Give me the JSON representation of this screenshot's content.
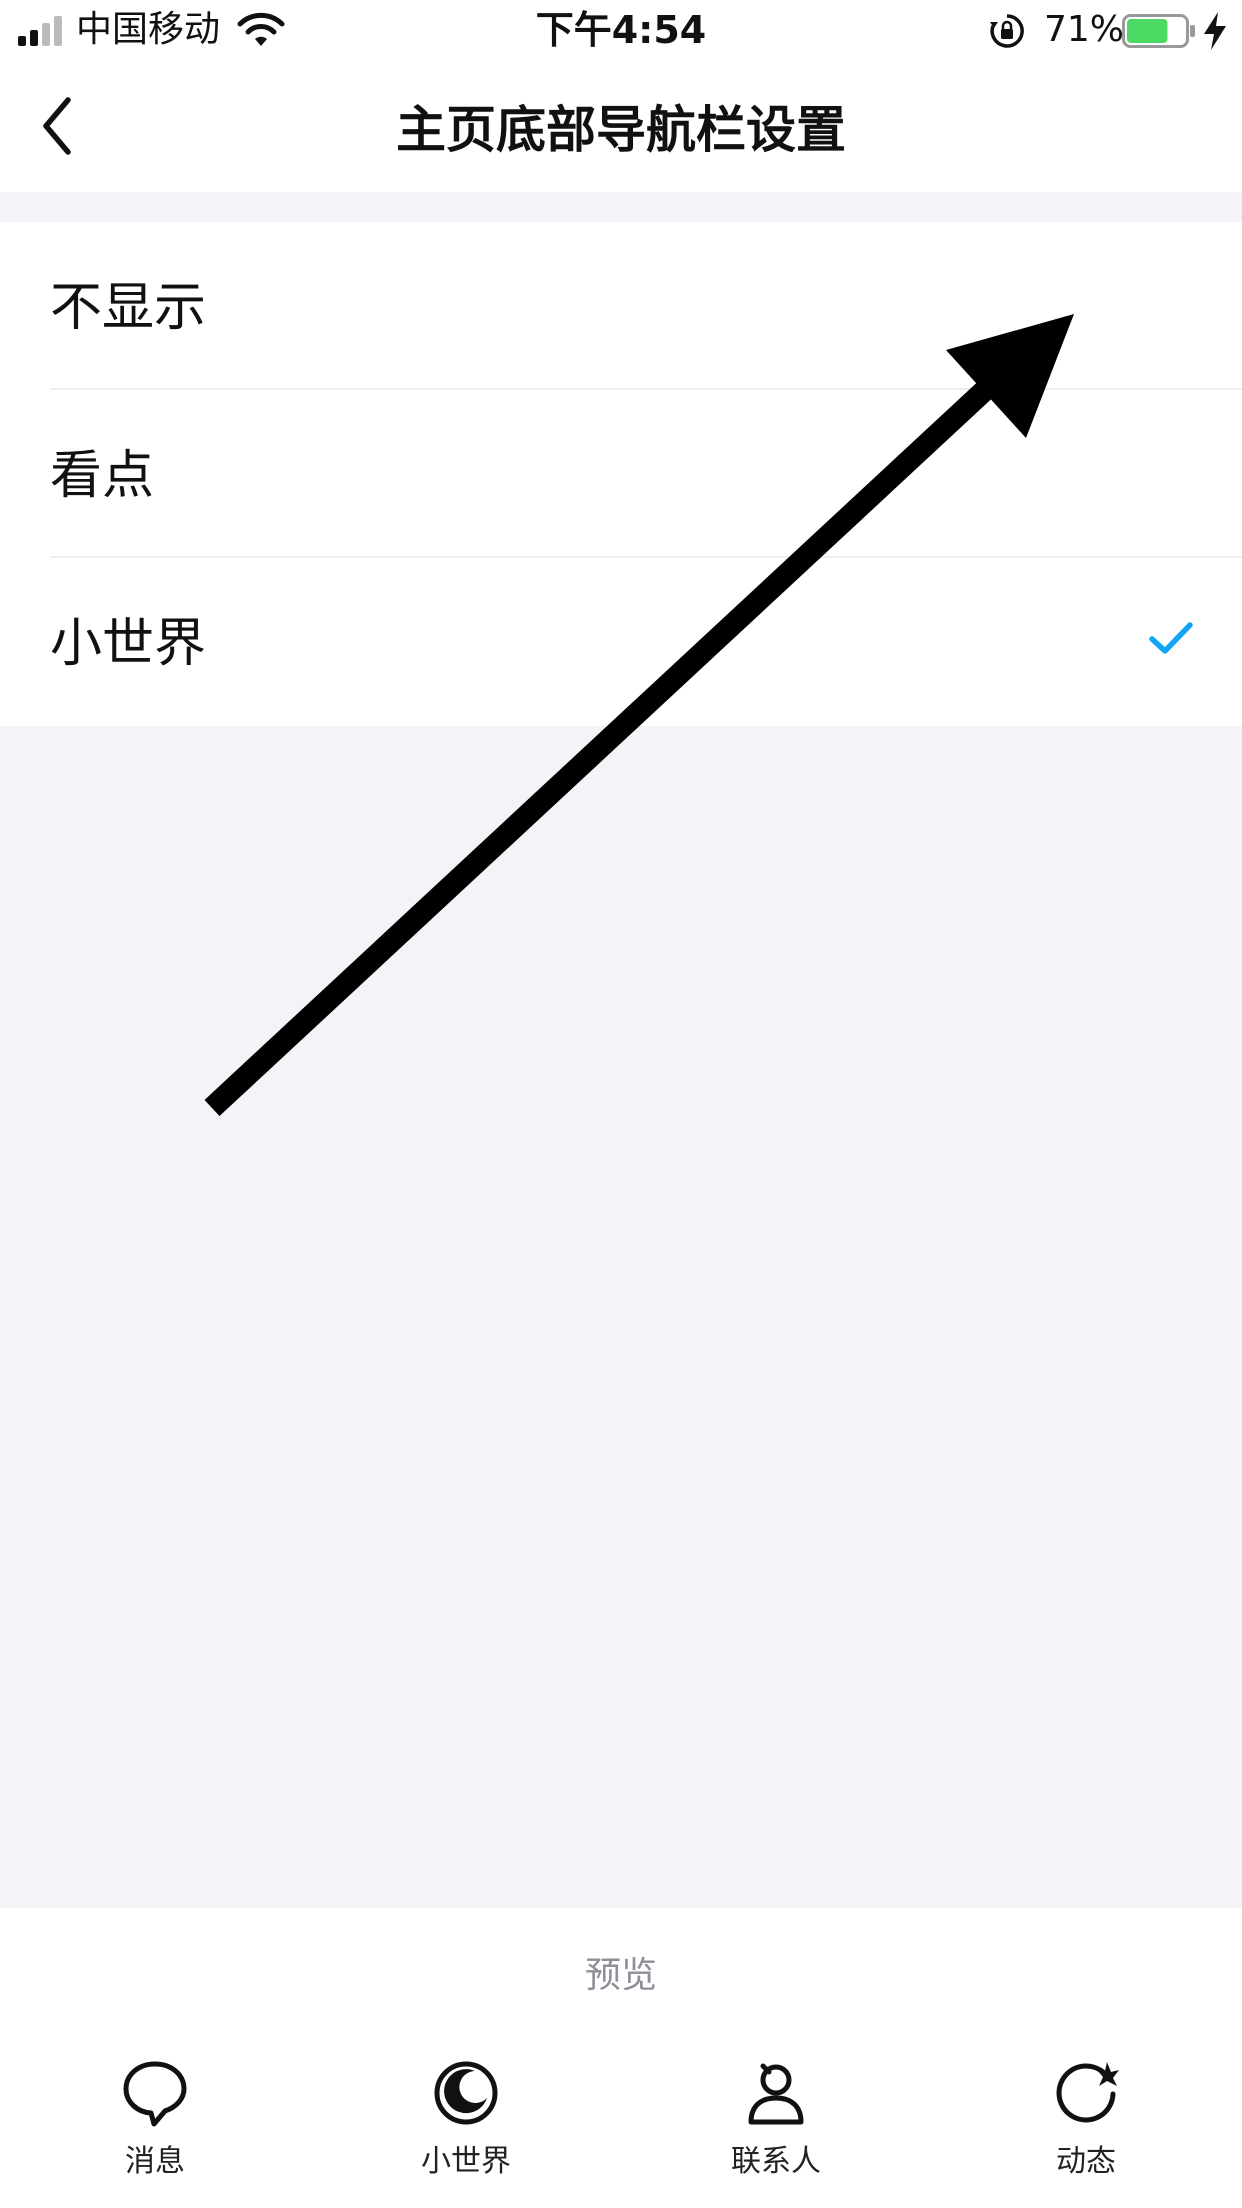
{
  "status_bar": {
    "carrier": "中国移动",
    "time": "下午4:54",
    "battery_percent": "71%",
    "battery_level": 0.71,
    "battery_color": "#4cd964"
  },
  "header": {
    "title": "主页底部导航栏设置",
    "back_icon": "chevron-left-icon"
  },
  "options": {
    "items": [
      {
        "label": "不显示",
        "selected": false
      },
      {
        "label": "看点",
        "selected": false
      },
      {
        "label": "小世界",
        "selected": true
      }
    ],
    "check_color": "#12a4f5"
  },
  "preview": {
    "title": "预览",
    "tabs": [
      {
        "label": "消息",
        "icon": "chat-bubble-icon"
      },
      {
        "label": "小世界",
        "icon": "world-icon"
      },
      {
        "label": "联系人",
        "icon": "contact-icon"
      },
      {
        "label": "动态",
        "icon": "moment-icon"
      }
    ]
  },
  "colors": {
    "background": "#f3f4f8",
    "surface": "#ffffff",
    "annotation_arrow": "#000000"
  }
}
